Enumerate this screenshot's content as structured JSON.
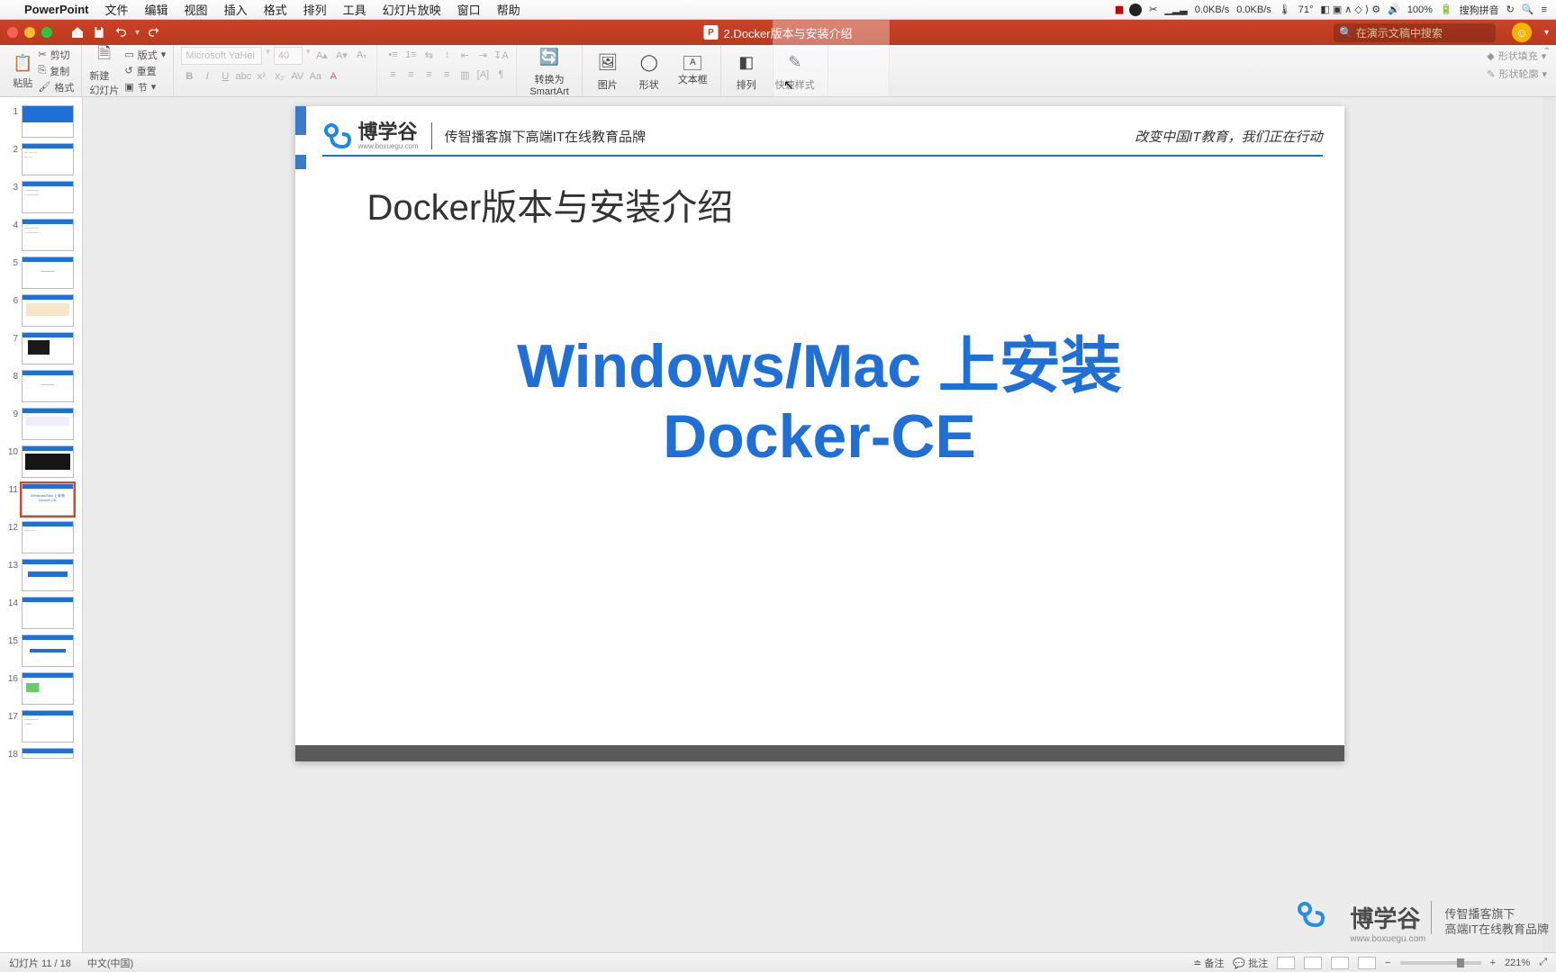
{
  "menubar": {
    "apple": "",
    "app": "PowerPoint",
    "items": [
      "文件",
      "编辑",
      "视图",
      "插入",
      "格式",
      "排列",
      "工具",
      "幻灯片放映",
      "窗口",
      "帮助"
    ],
    "right": {
      "net_up": "0.0KB/s",
      "net_down": "0.0KB/s",
      "temp": "71°",
      "battery": "100%",
      "ime": "搜狗拼音"
    }
  },
  "qat": {
    "docname": "2.Docker版本与安装介绍",
    "search_placeholder": "在演示文稿中搜索"
  },
  "ribbon": {
    "clipboard": {
      "paste": "粘贴",
      "cut": "剪切",
      "copy": "复制",
      "format": "格式"
    },
    "slides": {
      "new": "新建\n幻灯片",
      "layout": "版式",
      "reset": "重置",
      "section": "节"
    },
    "font": {
      "name": "Microsoft YaHei",
      "size": "40"
    },
    "convert": "转换为\nSmartArt",
    "insert": {
      "picture": "图片",
      "shapes": "形状",
      "textbox": "文本框",
      "arrange": "排列",
      "quickstyle": "快速样式",
      "shapeoutline": "形状轮廓",
      "shapefill": "形状填充"
    }
  },
  "thumbnails": {
    "count": 18,
    "selected": 11
  },
  "slide": {
    "brand": "博学谷",
    "brand_sub": "www.boxuegu.com",
    "brand_tag": "传智播客旗下高端IT在线教育品牌",
    "header_right": "改变中国IT教育，我们正在行动",
    "title": "Docker版本与安装介绍",
    "main_line1": "Windows/Mac 上安装",
    "main_line2": "Docker-CE"
  },
  "watermark": {
    "main": "博学谷",
    "sub": "www.boxuegu.com",
    "right1": "传智播客旗下",
    "right2": "高端IT在线教育品牌"
  },
  "status": {
    "slide_info": "幻灯片 11 / 18",
    "lang": "中文(中国)",
    "notes": "备注",
    "comments": "批注",
    "zoom": "221%"
  }
}
